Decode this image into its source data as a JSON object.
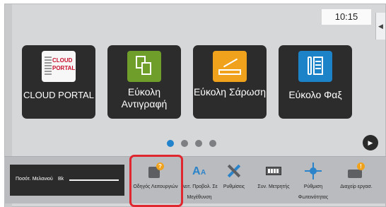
{
  "status": {
    "time": "10:15"
  },
  "apps": [
    {
      "label": "CLOUD PORTAL",
      "icon": "cloud-portal-icon",
      "logo_lines": [
        "CLOUD",
        "PORTAL"
      ]
    },
    {
      "label": "Εύκολη Αντιγραφή",
      "icon": "copy-icon"
    },
    {
      "label": "Εύκολη Σάρωση",
      "icon": "scan-icon"
    },
    {
      "label": "Εύκολο Φαξ",
      "icon": "fax-icon"
    }
  ],
  "pager": {
    "pages": 4,
    "active": 1
  },
  "toner": {
    "label": "Ποσότ. Μελανιού",
    "color_label": "Bk"
  },
  "functions": [
    {
      "label": "Οδηγός Λειτουργιών",
      "icon": "operation-guide-icon"
    },
    {
      "label": "Λειτ. Προβολ. Σε Μεγέθυνση",
      "icon": "enlarged-display-icon"
    },
    {
      "label": "Ρυθμίσεις",
      "icon": "settings-tools-icon"
    },
    {
      "label": "Συν. Μετρητής",
      "icon": "total-count-icon"
    },
    {
      "label": "Ρύθμιση Φωτεινότητας",
      "icon": "brightness-icon"
    },
    {
      "label": "Διαχείρ εργασ.",
      "icon": "job-status-icon"
    }
  ],
  "colors": {
    "accent": "#2283cc",
    "highlight": "#e0262f"
  }
}
